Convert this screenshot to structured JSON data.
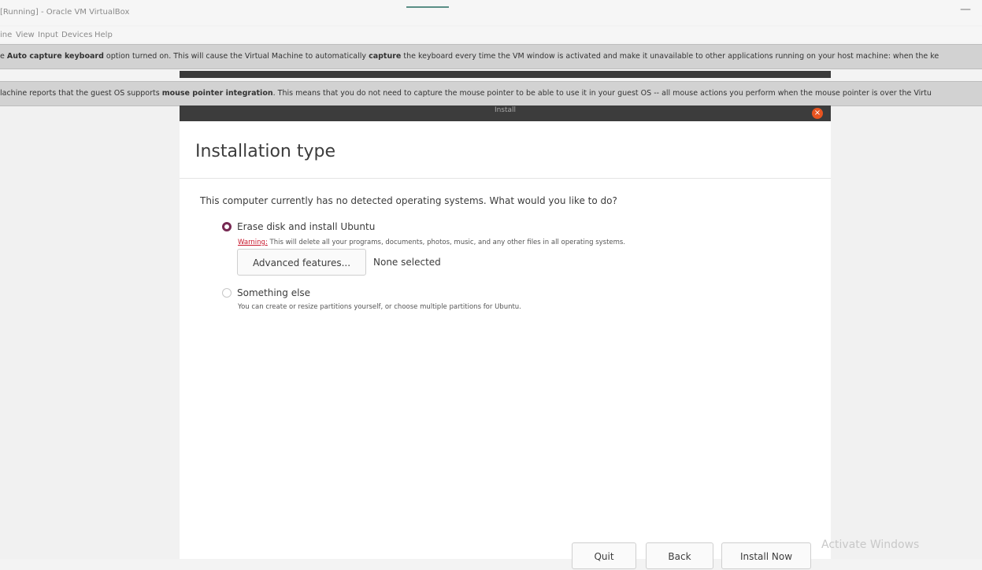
{
  "window": {
    "title": "[Running] - Oracle VM VirtualBox"
  },
  "menu": [
    "ine",
    "View",
    "Input",
    "Devices",
    "Help"
  ],
  "notifications": [
    {
      "segments": [
        {
          "text": "e ",
          "bold": false
        },
        {
          "text": "Auto capture keyboard",
          "bold": true
        },
        {
          "text": " option turned on. This will cause the Virtual Machine to automatically ",
          "bold": false
        },
        {
          "text": "capture",
          "bold": true
        },
        {
          "text": " the keyboard every time the VM window is activated and make it unavailable to other applications running on your host machine: when the ke",
          "bold": false
        }
      ]
    },
    {
      "segments": [
        {
          "text": "lachine reports that the guest OS supports ",
          "bold": false
        },
        {
          "text": "mouse pointer integration",
          "bold": true
        },
        {
          "text": ". This means that you do not need to capture the mouse pointer to be able to use it in your guest OS -- all mouse actions you perform when the mouse pointer is over the Virtu",
          "bold": false
        }
      ]
    }
  ],
  "installer": {
    "header_title": "Install",
    "close_icon": "×",
    "page_title": "Installation type",
    "question": "This computer currently has no detected operating systems. What would you like to do?",
    "option_erase": {
      "label": "Erase disk and install Ubuntu",
      "warning_lead": "Warning:",
      "warning_text": " This will delete all your programs, documents, photos, music, and any other files in all operating systems.",
      "selected": true
    },
    "advanced_button": "Advanced features...",
    "advanced_status": "None selected",
    "option_else": {
      "label": "Something else",
      "description": "You can create or resize partitions yourself, or choose multiple partitions for Ubuntu.",
      "selected": false
    },
    "buttons": {
      "quit": "Quit",
      "back": "Back",
      "install_now": "Install Now"
    }
  },
  "watermark": "Activate Windows",
  "colors": {
    "accent_radio": "#772953",
    "warning": "#c7162b",
    "close_button": "#e95420"
  }
}
